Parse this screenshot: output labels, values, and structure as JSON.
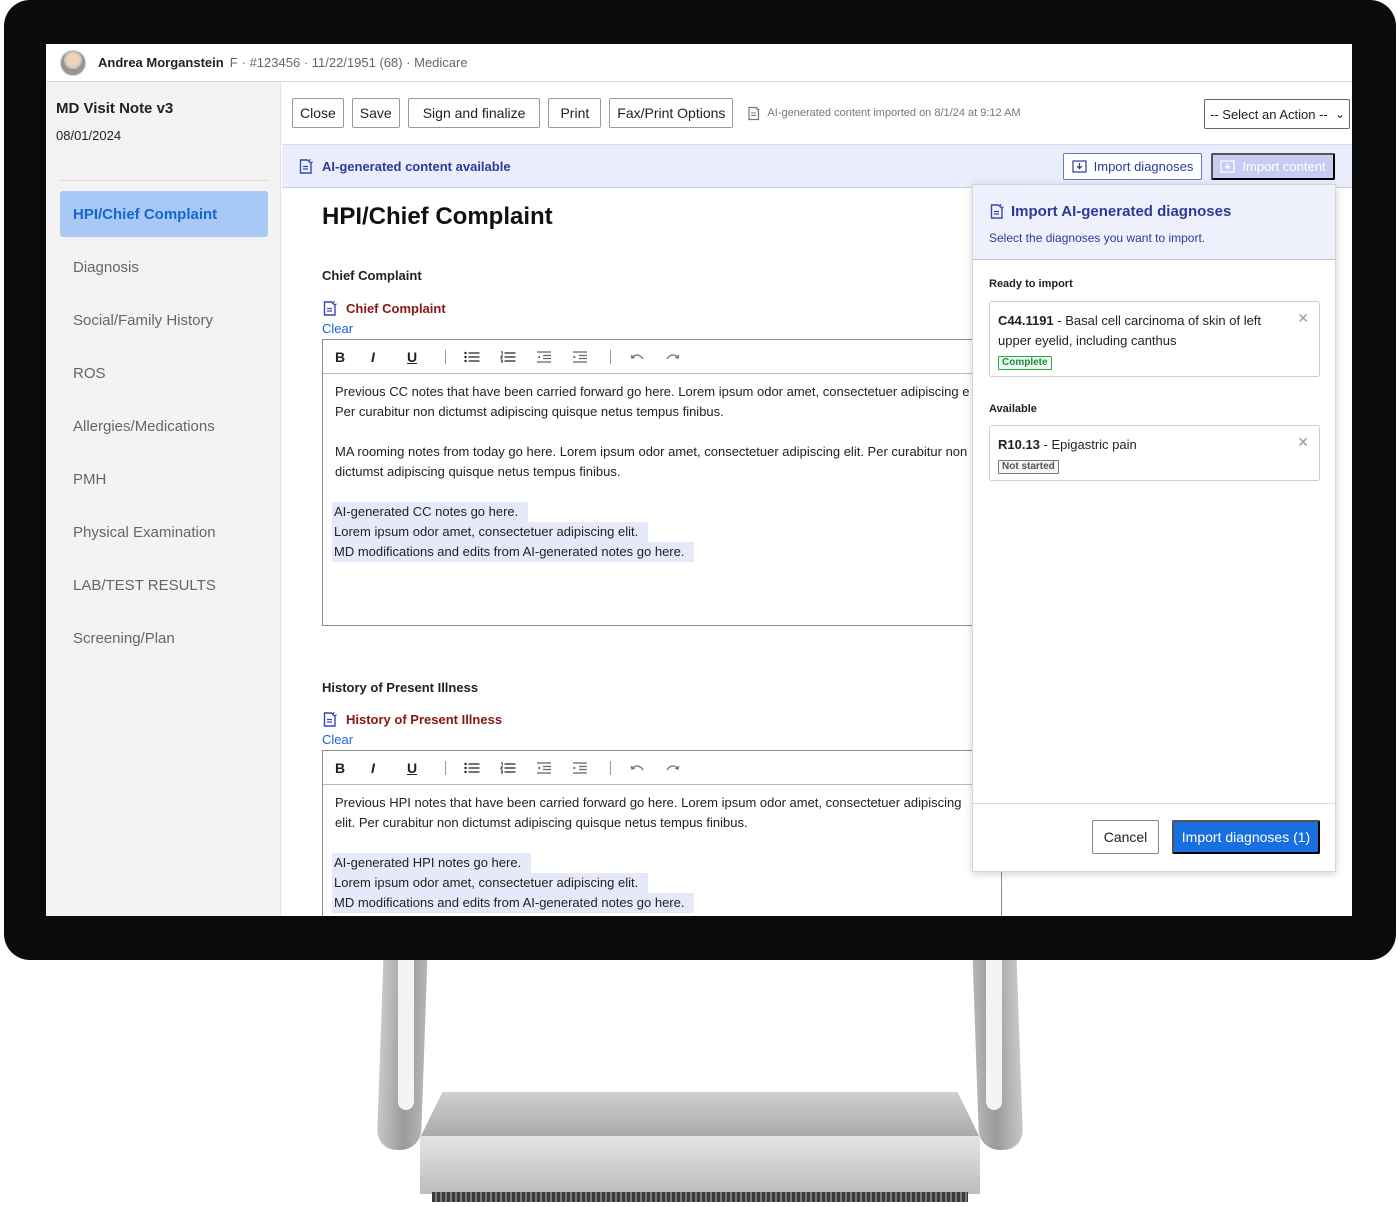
{
  "patient": {
    "name": "Andrea Morganstein",
    "sex": "F",
    "meta": "· #123456 · 11/22/1951 (68) · Medicare"
  },
  "note": {
    "title": "MD Visit Note v3",
    "date": "08/01/2024"
  },
  "sidebar": {
    "items": [
      {
        "label": "HPI/Chief Complaint",
        "active": true
      },
      {
        "label": "Diagnosis"
      },
      {
        "label": "Social/Family History"
      },
      {
        "label": "ROS"
      },
      {
        "label": "Allergies/Medications"
      },
      {
        "label": "PMH"
      },
      {
        "label": "Physical Examination"
      },
      {
        "label": "LAB/TEST RESULTS"
      },
      {
        "label": "Screening/Plan"
      }
    ]
  },
  "toolbar": {
    "close": "Close",
    "save": "Save",
    "sign": "Sign and finalize",
    "print": "Print",
    "fax": "Fax/Print Options",
    "ai_imported_note": "AI-generated content imported on 8/1/24 at 9:12 AM",
    "action_select": "-- Select an Action --"
  },
  "banner": {
    "text": "AI-generated content available",
    "import_diagnoses": "Import diagnoses",
    "import_content": "Import content"
  },
  "main": {
    "title": "HPI/Chief Complaint",
    "editor_tools": {
      "bold": "B",
      "italic": "I",
      "underline": "U"
    },
    "chief_complaint": {
      "section": "Chief Complaint",
      "ai_label": "Chief Complaint",
      "clear": "Clear",
      "carried": "Previous CC notes that have been carried forward go here. Lorem ipsum odor amet, consectetuer adipiscing e",
      "carried2": "Per curabitur non dictumst adipiscing quisque netus tempus finibus.",
      "rooming": "MA rooming notes from today go here. Lorem ipsum odor amet, consectetuer adipiscing elit. Per curabitur non",
      "rooming2": "dictumst adipiscing quisque netus tempus finibus.",
      "ai1": "AI-generated CC notes go here.",
      "ai2": "Lorem ipsum odor amet, consectetuer adipiscing elit.",
      "ai3": "MD modifications and edits from AI-generated notes go here."
    },
    "hpi": {
      "section": "History of Present Illness",
      "ai_label": "History of Present Illness",
      "clear": "Clear",
      "carried": "Previous HPI notes that have been carried forward go here. Lorem ipsum odor amet, consectetuer adipiscing",
      "carried2": "elit. Per curabitur non dictumst adipiscing quisque netus tempus finibus.",
      "ai1": "AI-generated HPI notes go here.",
      "ai2": "Lorem ipsum odor amet, consectetuer adipiscing elit.",
      "ai3": "MD modifications and edits from AI-generated notes go here."
    }
  },
  "panel": {
    "title": "Import AI-generated diagnoses",
    "subtitle": "Select the diagnoses you want to import.",
    "ready_label": "Ready to import",
    "available_label": "Available",
    "ready": [
      {
        "code": "C44.1191",
        "desc": " - Basal cell carcinoma of skin of left upper eyelid, including canthus",
        "status": "Complete"
      }
    ],
    "available": [
      {
        "code": "R10.13",
        "desc": " - Epigastric pain",
        "status": "Not started"
      }
    ],
    "cancel": "Cancel",
    "import": "Import diagnoses (1)"
  },
  "colors": {
    "accent": "#1a6fe0",
    "ai_indigo": "#2d3a9a",
    "ai_label_red": "#8a1616",
    "complete_green": "#1c8f3b"
  }
}
